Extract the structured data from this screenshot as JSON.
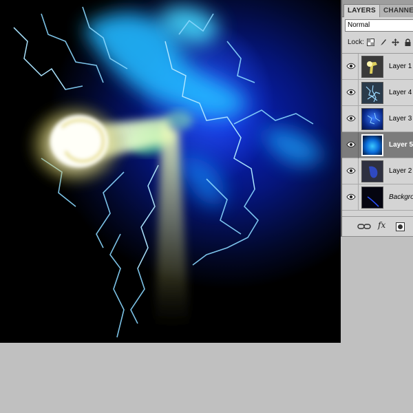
{
  "panel": {
    "tabs": [
      {
        "label": "LAYERS",
        "active": true
      },
      {
        "label": "CHANNE",
        "active": false
      }
    ],
    "blend_mode": "Normal",
    "lock_label": "Lock:",
    "layers": [
      {
        "name": "Layer 1",
        "visible": true,
        "selected": false,
        "thumb": "yellow-streak"
      },
      {
        "name": "Layer 4",
        "visible": true,
        "selected": false,
        "thumb": "blue-lightning"
      },
      {
        "name": "Layer 3",
        "visible": true,
        "selected": false,
        "thumb": "blue-glow"
      },
      {
        "name": "Layer 5",
        "visible": true,
        "selected": true,
        "thumb": "cyan-orb"
      },
      {
        "name": "Layer 2",
        "visible": true,
        "selected": false,
        "thumb": "blue-smoke"
      },
      {
        "name": "Backgro",
        "visible": true,
        "selected": false,
        "thumb": "dark-curve",
        "italic": true
      }
    ],
    "footer_icons": [
      "link-icon",
      "fx-icon",
      "mask-icon"
    ],
    "fx_label": "fx"
  },
  "colors": {
    "selected_row": "#7c7c7c",
    "panel_bg": "#d4d4d4",
    "workspace_bg": "#c0c0c0"
  }
}
